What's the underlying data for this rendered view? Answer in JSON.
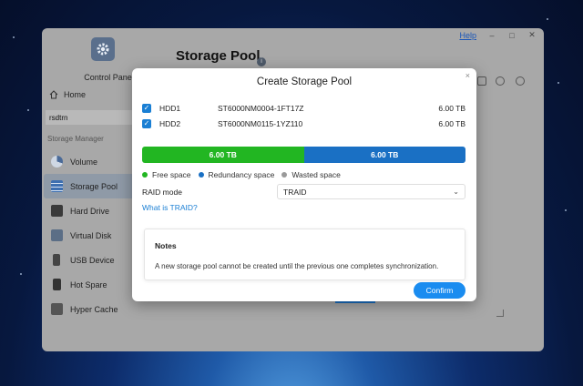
{
  "window": {
    "help_label": "Help",
    "minimize": "–",
    "maximize": "□",
    "close": "✕"
  },
  "sidebar": {
    "app_title": "Control Panel",
    "home_label": "Home",
    "search_value": "rsdtrn",
    "section_label": "Storage Manager",
    "items": [
      {
        "label": "Volume",
        "icon": "pie-icon"
      },
      {
        "label": "Storage Pool",
        "icon": "stack-icon",
        "active": true
      },
      {
        "label": "Hard Drive",
        "icon": "disk-icon"
      },
      {
        "label": "Virtual Disk",
        "icon": "virtual-disk-icon"
      },
      {
        "label": "USB Device",
        "icon": "usb-icon"
      },
      {
        "label": "Hot Spare",
        "icon": "hot-spare-icon"
      },
      {
        "label": "Hyper Cache",
        "icon": "cache-icon"
      }
    ]
  },
  "main": {
    "page_title": "Storage Pool"
  },
  "modal": {
    "title": "Create Storage Pool",
    "close": "×",
    "disks": [
      {
        "name": "HDD1",
        "model": "ST6000NM0004-1FT17Z",
        "size": "6.00 TB",
        "checked": true
      },
      {
        "name": "HDD2",
        "model": "ST6000NM0115-1YZ110",
        "size": "6.00 TB",
        "checked": true
      }
    ],
    "bar": [
      {
        "label": "6.00 TB",
        "color": "#22b622",
        "fraction": 0.5
      },
      {
        "label": "6.00 TB",
        "color": "#1a70c4",
        "fraction": 0.5
      }
    ],
    "legend": [
      {
        "label": "Free space",
        "color": "#22b622"
      },
      {
        "label": "Redundancy space",
        "color": "#1a70c4"
      },
      {
        "label": "Wasted space",
        "color": "#9a9a9a"
      }
    ],
    "raid_label": "RAID mode",
    "raid_value": "TRAID",
    "raid_link": "What is TRAID?",
    "notes_title": "Notes",
    "notes_text": "A new storage pool cannot be created until the previous one completes synchronization.",
    "confirm_label": "Confirm"
  },
  "colors": {
    "accent": "#1a8cf0",
    "active_nav": "#8f9aa7"
  }
}
